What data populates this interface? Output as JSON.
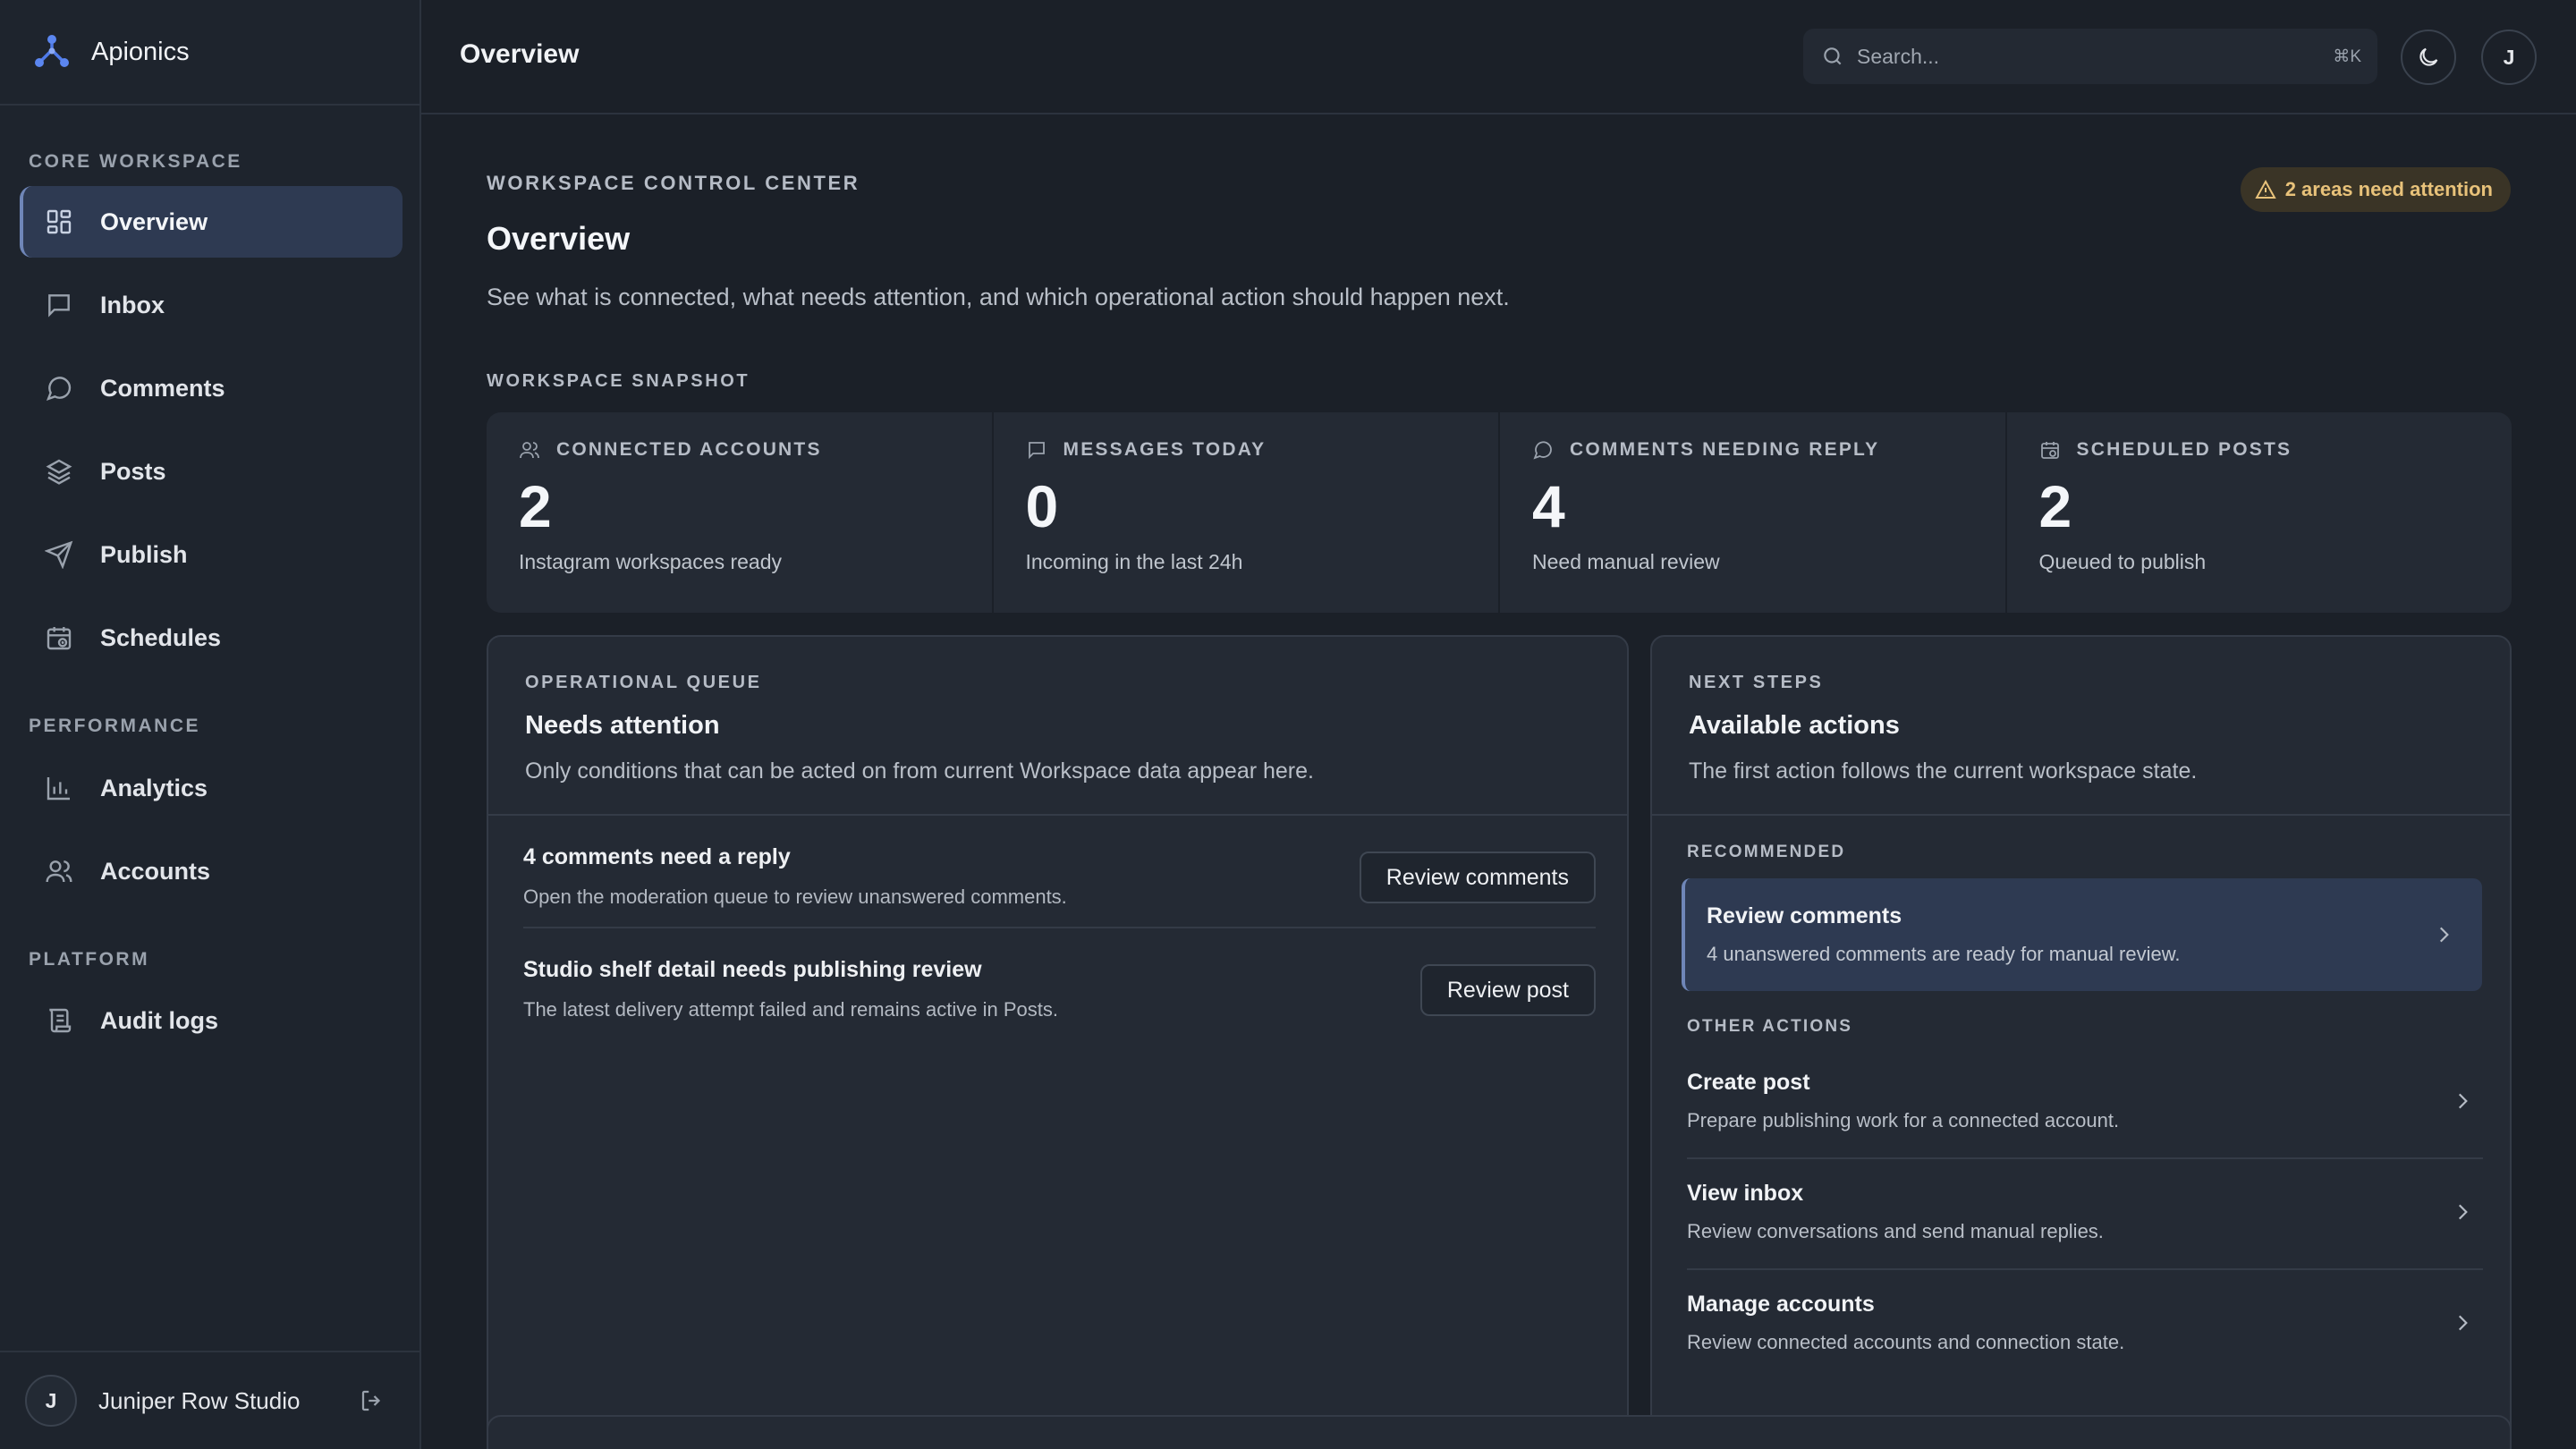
{
  "app": {
    "name": "Apionics"
  },
  "sidebar": {
    "sections": [
      {
        "label": "CORE WORKSPACE"
      },
      {
        "label": "PERFORMANCE"
      },
      {
        "label": "PLATFORM"
      }
    ],
    "items": [
      {
        "label": "Overview",
        "icon": "grid-icon",
        "active": true
      },
      {
        "label": "Inbox",
        "icon": "message-square-icon"
      },
      {
        "label": "Comments",
        "icon": "message-circle-icon"
      },
      {
        "label": "Posts",
        "icon": "layers-icon"
      },
      {
        "label": "Publish",
        "icon": "send-icon"
      },
      {
        "label": "Schedules",
        "icon": "calendar-clock-icon"
      },
      {
        "label": "Analytics",
        "icon": "bar-chart-icon"
      },
      {
        "label": "Accounts",
        "icon": "users-icon"
      },
      {
        "label": "Audit logs",
        "icon": "scroll-icon"
      }
    ],
    "user": {
      "initial": "J",
      "name": "Juniper Row Studio"
    }
  },
  "topbar": {
    "title": "Overview",
    "search_placeholder": "Search...",
    "shortcut": "⌘K",
    "avatar_initial": "J"
  },
  "page": {
    "eyebrow": "WORKSPACE CONTROL CENTER",
    "title": "Overview",
    "description": "See what is connected, what needs attention, and which operational action should happen next.",
    "attention_badge": "2 areas need attention",
    "snapshot_label": "WORKSPACE SNAPSHOT"
  },
  "stats": [
    {
      "label": "CONNECTED ACCOUNTS",
      "value": "2",
      "sub": "Instagram workspaces ready",
      "icon": "users-icon"
    },
    {
      "label": "MESSAGES TODAY",
      "value": "0",
      "sub": "Incoming in the last 24h",
      "icon": "message-square-icon"
    },
    {
      "label": "COMMENTS NEEDING REPLY",
      "value": "4",
      "sub": "Need manual review",
      "icon": "message-circle-icon"
    },
    {
      "label": "SCHEDULED POSTS",
      "value": "2",
      "sub": "Queued to publish",
      "icon": "calendar-clock-icon"
    }
  ],
  "queue": {
    "eyebrow": "OPERATIONAL QUEUE",
    "title": "Needs attention",
    "description": "Only conditions that can be acted on from current Workspace data appear here.",
    "items": [
      {
        "title": "4 comments need a reply",
        "sub": "Open the moderation queue to review unanswered comments.",
        "action": "Review comments"
      },
      {
        "title": "Studio shelf detail needs publishing review",
        "sub": "The latest delivery attempt failed and remains active in Posts.",
        "action": "Review post"
      }
    ]
  },
  "next_steps": {
    "eyebrow": "NEXT STEPS",
    "title": "Available actions",
    "description": "The first action follows the current workspace state.",
    "recommended_label": "RECOMMENDED",
    "recommended": {
      "title": "Review comments",
      "sub": "4 unanswered comments are ready for manual review."
    },
    "other_label": "OTHER ACTIONS",
    "other": [
      {
        "title": "Create post",
        "sub": "Prepare publishing work for a connected account."
      },
      {
        "title": "View inbox",
        "sub": "Review conversations and send manual replies."
      },
      {
        "title": "Manage accounts",
        "sub": "Review connected accounts and connection state."
      }
    ]
  },
  "colors": {
    "background": "#1b2028",
    "sidebar": "#1e242d",
    "card": "#242a34",
    "active": "#2e3a52",
    "accent": "#6f86b8",
    "brand": "#4f7ae8",
    "warning": "#e8c27a"
  }
}
